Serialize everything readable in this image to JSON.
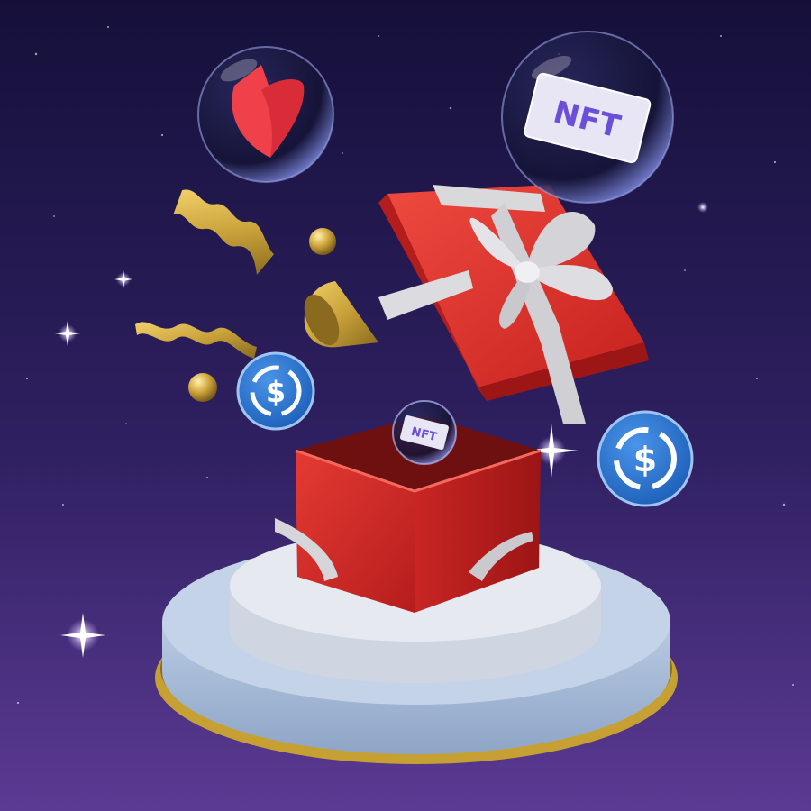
{
  "scene": {
    "nft_ticket_large": {
      "label": "NFT"
    },
    "nft_ticket_small": {
      "label": "NFT"
    },
    "colors": {
      "sky_top": "#15103a",
      "sky_bottom": "#5a3a92",
      "box_red": "#e0302c",
      "ribbon": "#d9d9dc",
      "coin_blue": "#2775ca",
      "gold": "#c9a23a",
      "podium_blue": "#a8bedb",
      "podium_top": "#dfe3ea",
      "heart_red": "#f0414a",
      "nft_purple": "#6b4fd9"
    },
    "icons": [
      "heart-token-icon",
      "nft-ticket-icon",
      "usdc-coin-icon",
      "gift-box-icon",
      "confetti-icon",
      "party-hat-icon"
    ]
  }
}
